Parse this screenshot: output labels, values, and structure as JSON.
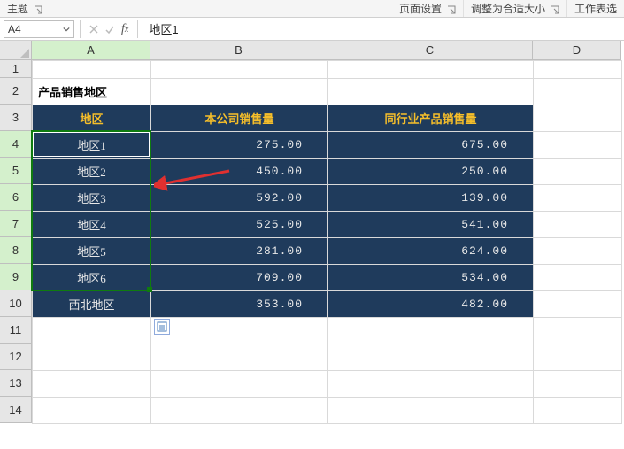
{
  "ribbon": {
    "themes": "主题",
    "page_setup": "页面设置",
    "scale_to_fit": "调整为合适大小",
    "sheet_options": "工作表选"
  },
  "namebox": {
    "value": "A4"
  },
  "formula": {
    "value": "地区1"
  },
  "columns": [
    "A",
    "B",
    "C",
    "D"
  ],
  "rows": [
    "1",
    "2",
    "3",
    "4",
    "5",
    "6",
    "7",
    "8",
    "9",
    "10",
    "11",
    "12",
    "13",
    "14"
  ],
  "title": "产品销售地区",
  "headers": {
    "a": "地区",
    "b": "本公司销售量",
    "c": "同行业产品销售量"
  },
  "data": [
    {
      "region": "地区1",
      "own": "275.00",
      "peer": "675.00"
    },
    {
      "region": "地区2",
      "own": "450.00",
      "peer": "250.00"
    },
    {
      "region": "地区3",
      "own": "592.00",
      "peer": "139.00"
    },
    {
      "region": "地区4",
      "own": "525.00",
      "peer": "541.00"
    },
    {
      "region": "地区5",
      "own": "281.00",
      "peer": "624.00"
    },
    {
      "region": "地区6",
      "own": "709.00",
      "peer": "534.00"
    },
    {
      "region": "西北地区",
      "own": "353.00",
      "peer": "482.00"
    }
  ],
  "selection": {
    "ref": "A4:A9"
  },
  "chart_data": {
    "type": "table",
    "title": "产品销售地区",
    "columns": [
      "地区",
      "本公司销售量",
      "同行业产品销售量"
    ],
    "rows": [
      [
        "地区1",
        275.0,
        675.0
      ],
      [
        "地区2",
        450.0,
        250.0
      ],
      [
        "地区3",
        592.0,
        139.0
      ],
      [
        "地区4",
        525.0,
        541.0
      ],
      [
        "地区5",
        281.0,
        624.0
      ],
      [
        "地区6",
        709.0,
        534.0
      ],
      [
        "西北地区",
        353.0,
        482.0
      ]
    ]
  }
}
